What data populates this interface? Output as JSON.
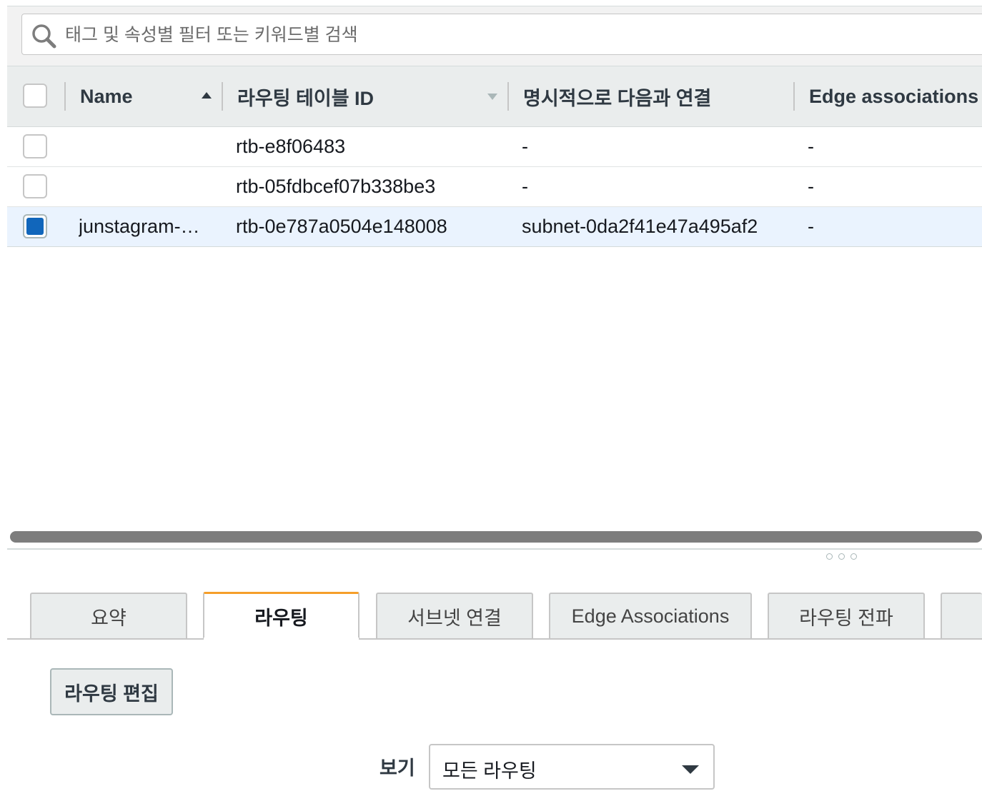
{
  "search": {
    "placeholder": "태그 및 속성별 필터 또는 키워드별 검색"
  },
  "table": {
    "columns": [
      {
        "label": "Name",
        "sort": "ascending"
      },
      {
        "label": "라우팅 테이블 ID",
        "sort": "none"
      },
      {
        "label": "명시적으로 다음과 연결"
      },
      {
        "label": "Edge associations"
      }
    ],
    "rows": [
      {
        "selected": false,
        "name": "",
        "route_table_id": "rtb-e8f06483",
        "explicit_association": "-",
        "edge_associations": "-"
      },
      {
        "selected": false,
        "name": "",
        "route_table_id": "rtb-05fdbcef07b338be3",
        "explicit_association": "-",
        "edge_associations": "-"
      },
      {
        "selected": true,
        "name": "junstagram-…",
        "route_table_id": "rtb-0e787a0504e148008",
        "explicit_association": "subnet-0da2f41e47a495af2",
        "edge_associations": "-"
      }
    ]
  },
  "tabs": [
    {
      "label": "요약",
      "active": false
    },
    {
      "label": "라우팅",
      "active": true
    },
    {
      "label": "서브넷 연결",
      "active": false
    },
    {
      "label": "Edge Associations",
      "active": false
    },
    {
      "label": "라우팅 전파",
      "active": false
    },
    {
      "label": "",
      "active": false
    }
  ],
  "actions": {
    "edit_routes": "라우팅 편집"
  },
  "view_filter": {
    "label": "보기",
    "selected": "모든 라우팅"
  },
  "colors": {
    "accent_tab": "#f59e2a",
    "checkbox_selected": "#1166bb",
    "selected_row": "#eaf3fe"
  }
}
